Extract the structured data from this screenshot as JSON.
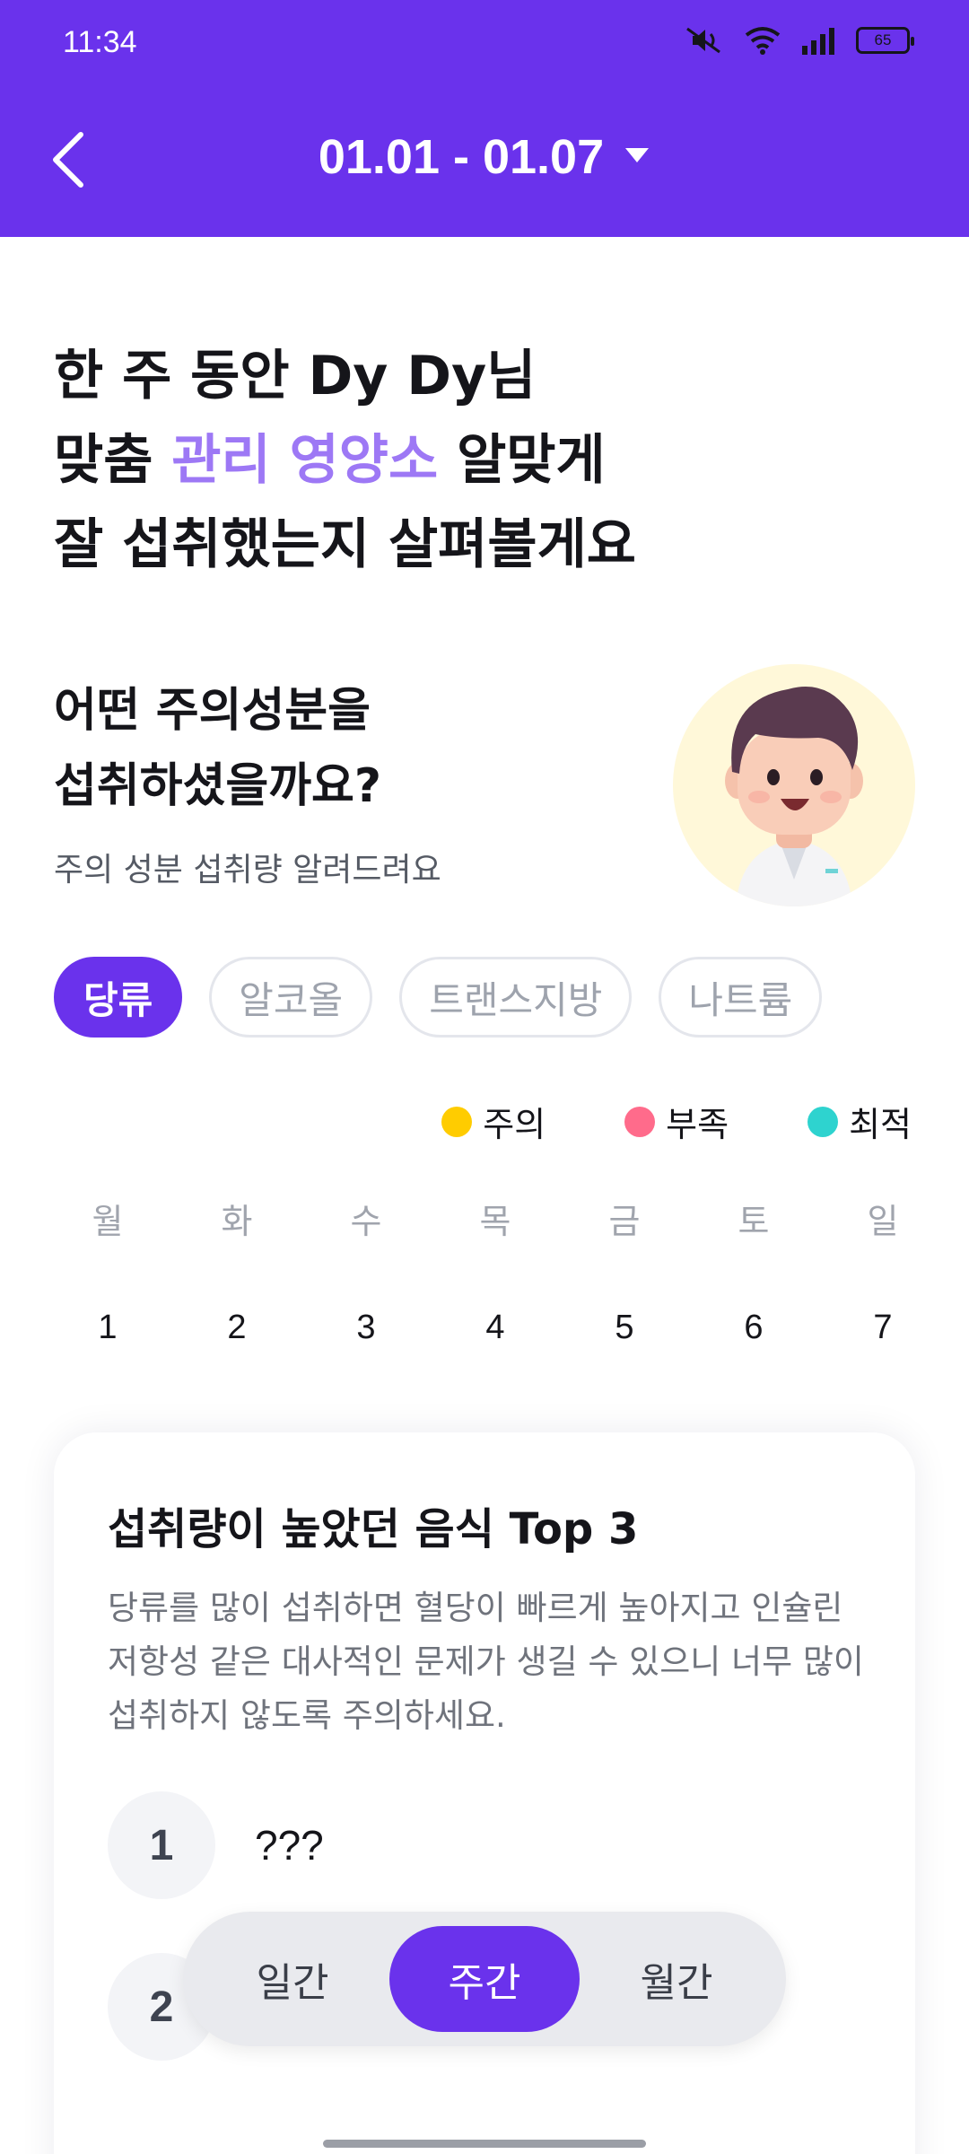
{
  "status_bar": {
    "time": "11:34",
    "battery": "65",
    "icons": [
      "mute-icon",
      "wifi-icon",
      "signal-icon",
      "battery-icon"
    ]
  },
  "header": {
    "date_range": "01.01 - 01.07",
    "back_icon": "chevron-left-icon",
    "dropdown_icon": "caret-down-icon"
  },
  "headline": {
    "line1": "한 주 동안 Dy Dy님",
    "line2_before": "맞춤 ",
    "line2_accent": "관리 영양소",
    "line2_after": " 알맞게",
    "line3": "잘 섭취했는지 살펴볼게요"
  },
  "section": {
    "title_line1": "어떤 주의성분을",
    "title_line2": "섭취하셨을까요?",
    "subtitle": "주의 성분 섭취량 알려드려요"
  },
  "chips": [
    {
      "label": "당류",
      "active": true
    },
    {
      "label": "알코올",
      "active": false
    },
    {
      "label": "트랜스지방",
      "active": false
    },
    {
      "label": "나트륨",
      "active": false
    }
  ],
  "legend": [
    {
      "label": "주의",
      "color": "#ffcc00"
    },
    {
      "label": "부족",
      "color": "#ff6b8b"
    },
    {
      "label": "최적",
      "color": "#2ed3cf"
    }
  ],
  "calendar": {
    "weekdays": [
      "월",
      "화",
      "수",
      "목",
      "금",
      "토",
      "일"
    ],
    "days": [
      "1",
      "2",
      "3",
      "4",
      "5",
      "6",
      "7"
    ]
  },
  "top_foods": {
    "title": "섭취량이 높았던 음식 Top 3",
    "description": "당류를 많이 섭취하면 혈당이 빠르게 높아지고 인슐린 저항성 같은 대사적인 문제가 생길 수 있으니 너무 많이 섭취하지 않도록 주의하세요.",
    "items": [
      {
        "rank": "1",
        "name": "???"
      },
      {
        "rank": "2",
        "name": ""
      }
    ]
  },
  "period_toggle": {
    "options": [
      "일간",
      "주간",
      "월간"
    ],
    "selected": "주간"
  },
  "colors": {
    "brand": "#6a32ec",
    "accent_text": "#9d78f5"
  }
}
